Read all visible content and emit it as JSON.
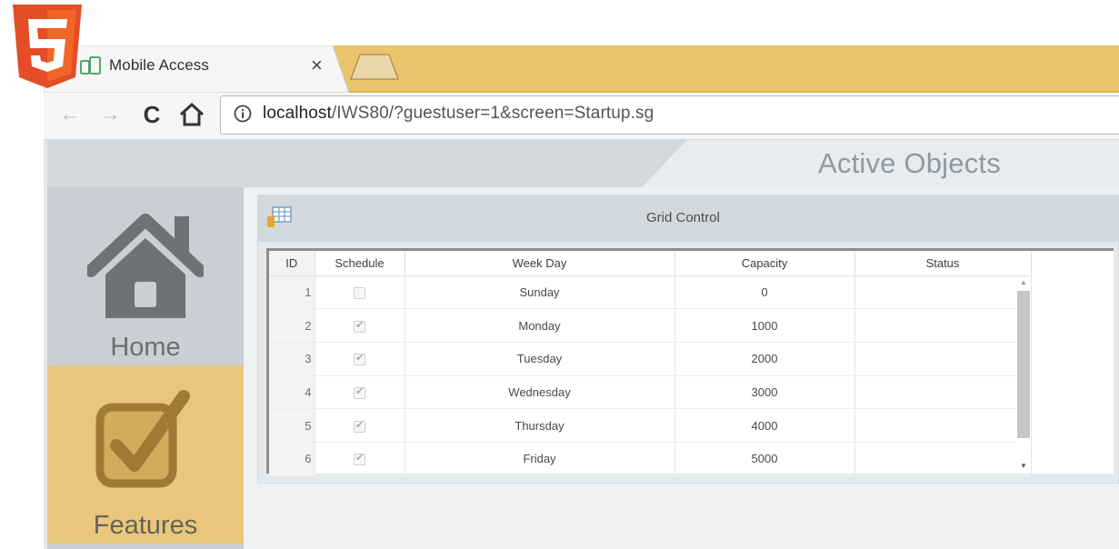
{
  "browser": {
    "tab_title": "Mobile Access",
    "tab_close": "×",
    "url_host": "localhost",
    "url_path": "/IWS80/?guestuser=1&screen=Startup.sg",
    "back_glyph": "←",
    "forward_glyph": "→",
    "reload_glyph": "C",
    "icons": [
      "html5-logo-icon",
      "favicon-icon",
      "back-arrow-icon",
      "forward-arrow-icon",
      "reload-icon",
      "home-icon",
      "info-icon"
    ]
  },
  "app": {
    "title": "Active Objects"
  },
  "sidebar": {
    "items": [
      {
        "label": "Home",
        "icon": "house-icon",
        "active": false
      },
      {
        "label": "Features",
        "icon": "checkbox-check-icon",
        "active": true
      }
    ]
  },
  "panel": {
    "title": "Grid Control",
    "icon": "grid-table-icon"
  },
  "grid": {
    "columns": [
      "ID",
      "Schedule",
      "Week Day",
      "Capacity",
      "Status"
    ],
    "rows": [
      {
        "id": "1",
        "schedule": false,
        "week_day": "Sunday",
        "capacity": "0",
        "status": ""
      },
      {
        "id": "2",
        "schedule": true,
        "week_day": "Monday",
        "capacity": "1000",
        "status": ""
      },
      {
        "id": "3",
        "schedule": true,
        "week_day": "Tuesday",
        "capacity": "2000",
        "status": ""
      },
      {
        "id": "4",
        "schedule": true,
        "week_day": "Wednesday",
        "capacity": "3000",
        "status": ""
      },
      {
        "id": "5",
        "schedule": true,
        "week_day": "Thursday",
        "capacity": "4000",
        "status": ""
      },
      {
        "id": "6",
        "schedule": true,
        "week_day": "Friday",
        "capacity": "5000",
        "status": ""
      }
    ]
  },
  "colors": {
    "tab_strip": "#ecc46b",
    "features_tile": "#e8c77c",
    "sidebar": "#cfd5d9",
    "title_text": "#8c9aa5"
  }
}
